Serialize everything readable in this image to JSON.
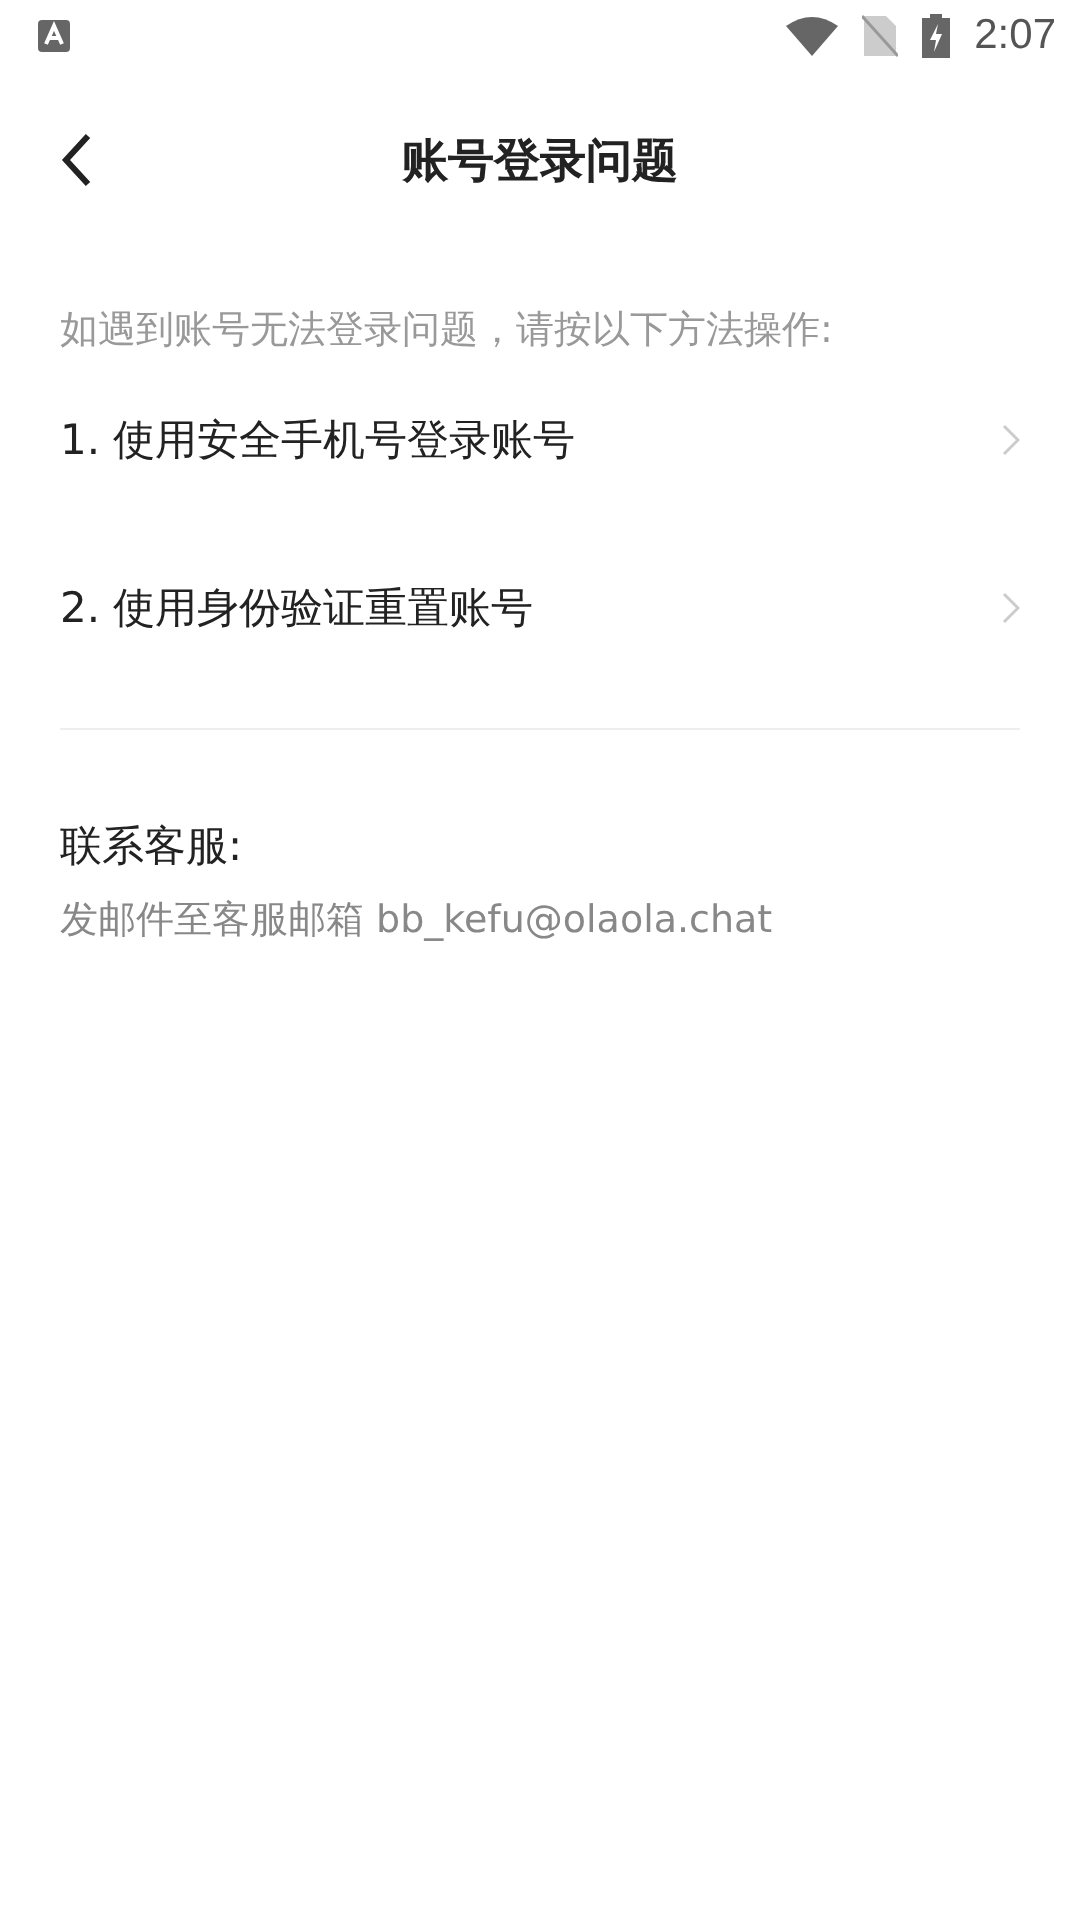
{
  "status_bar": {
    "time": "2:07"
  },
  "header": {
    "title": "账号登录问题"
  },
  "intro": "如遇到账号无法登录问题，请按以下方法操作:",
  "options": [
    {
      "label": "1. 使用安全手机号登录账号"
    },
    {
      "label": "2. 使用身份验证重置账号"
    }
  ],
  "contact": {
    "label": "联系客服:",
    "text": "发邮件至客服邮箱 bb_kefu@olaola.chat"
  }
}
